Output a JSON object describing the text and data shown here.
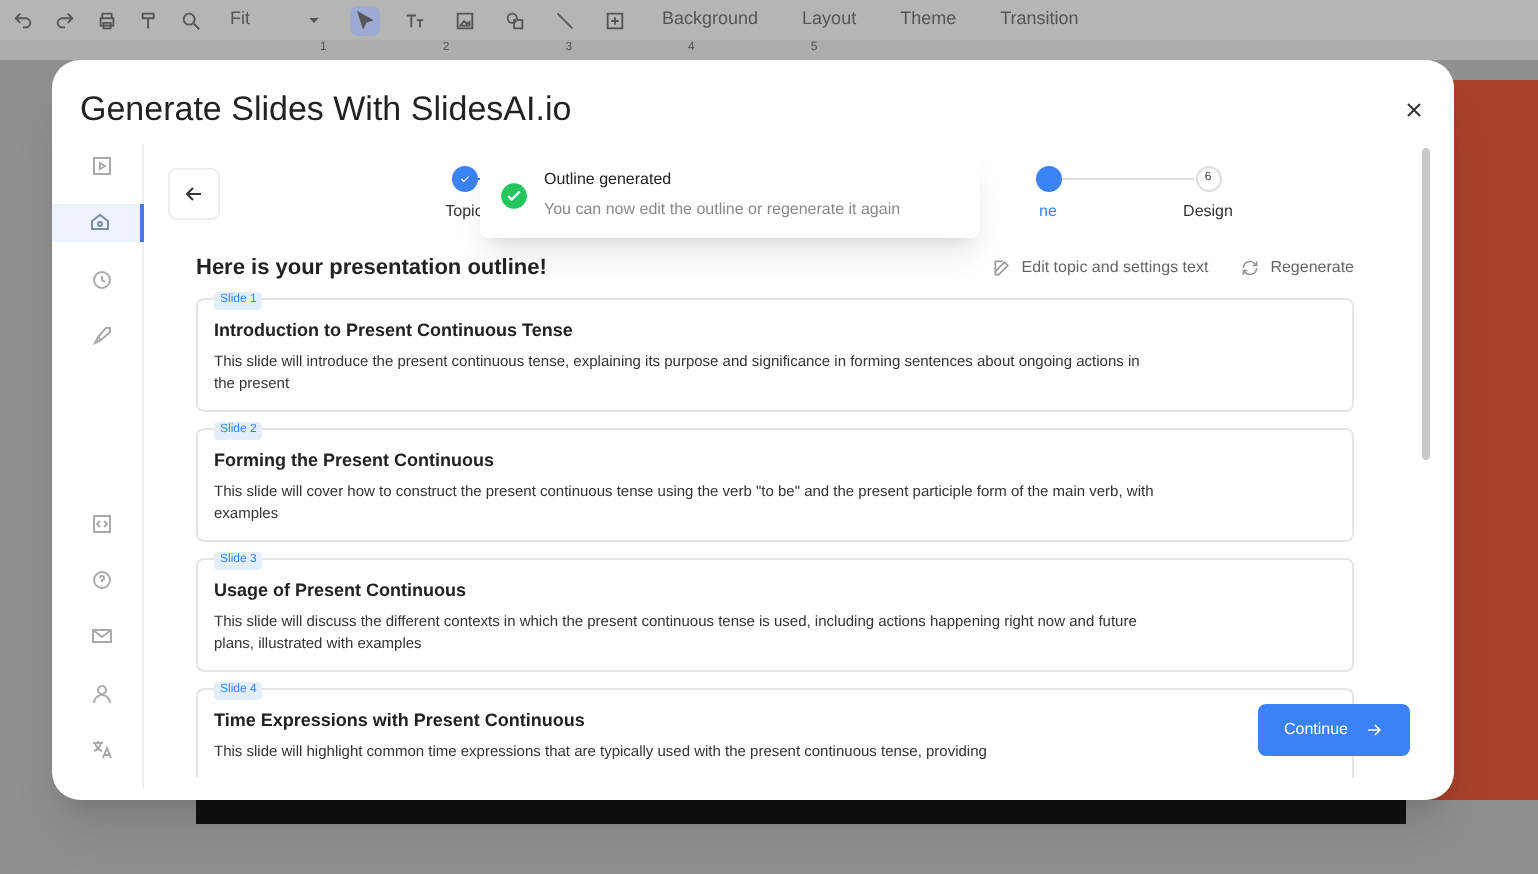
{
  "toolbar": {
    "zoom": "Fit",
    "tools": [
      {
        "selected": true
      },
      {
        "selected": false
      },
      {
        "selected": false
      },
      {
        "selected": false
      },
      {
        "selected": false
      },
      {
        "selected": false
      }
    ],
    "menu": [
      "Background",
      "Layout",
      "Theme",
      "Transition"
    ]
  },
  "ruler": [
    "1",
    "2",
    "3",
    "4",
    "5"
  ],
  "dialog": {
    "title": "Generate Slides With SlidesAI.io",
    "sidebar": [
      {
        "selected": false
      },
      {
        "selected": true
      },
      {
        "selected": false
      },
      {
        "selected": false
      },
      {
        "selected": false
      },
      {
        "selected": false
      },
      {
        "selected": false
      },
      {
        "selected": false
      },
      {
        "selected": false
      }
    ],
    "steps": [
      {
        "label": "Topic",
        "completed": true,
        "active": false
      },
      {
        "label": "ne",
        "completed": false,
        "active": true
      },
      {
        "number": "6",
        "label": "Design",
        "completed": false,
        "active": false
      }
    ],
    "toast": {
      "title": "Outline generated",
      "message": "You can now edit the outline or regenerate it again"
    },
    "heading": "Here is your presentation outline!",
    "actions": [
      "Edit topic and settings text",
      "Regenerate"
    ],
    "slides": [
      {
        "badge": "Slide 1",
        "title": "Introduction to Present Continuous Tense",
        "description": "This slide will introduce the present continuous tense, explaining its purpose and significance in forming sentences about ongoing actions in the present"
      },
      {
        "badge": "Slide 2",
        "title": "Forming the Present Continuous",
        "description": "This slide will cover how to construct the present continuous tense using the verb \"to be\" and the present participle form of the main verb, with examples"
      },
      {
        "badge": "Slide 3",
        "title": "Usage of Present Continuous",
        "description": "This slide will discuss the different contexts in which the present continuous tense is used, including actions happening right now and future plans, illustrated with examples"
      },
      {
        "badge": "Slide 4",
        "title": "Time Expressions with Present Continuous",
        "description": "This slide will highlight common time expressions that are typically used with the present continuous tense, providing"
      }
    ],
    "continue": "Continue"
  }
}
